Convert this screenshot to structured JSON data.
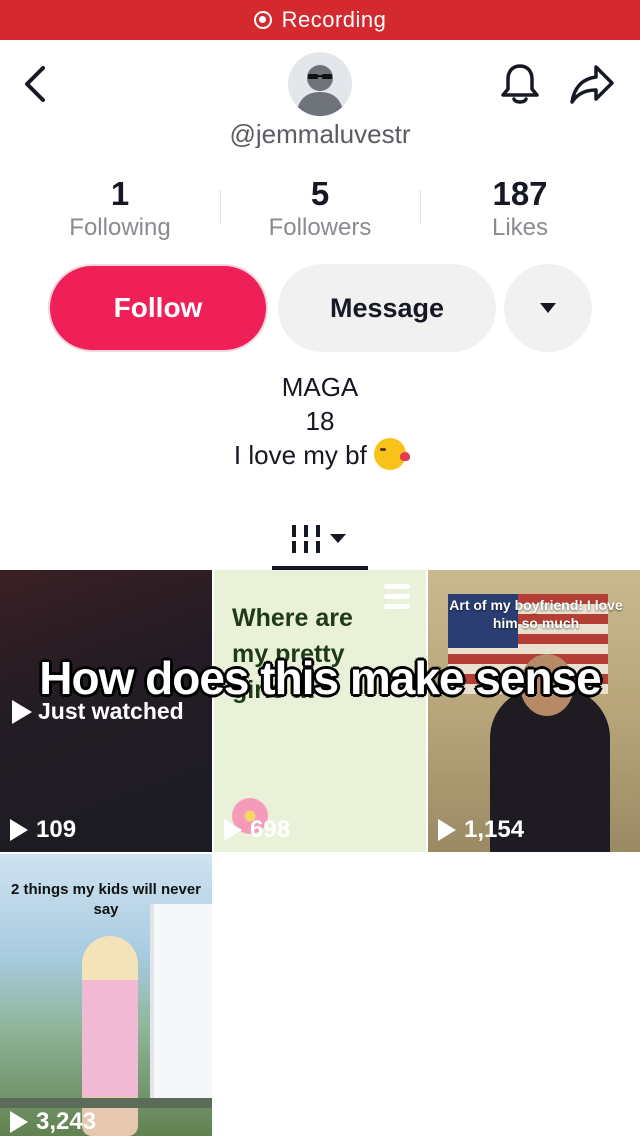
{
  "status_bar": {
    "recording_label": "Recording"
  },
  "header": {
    "back_icon": "chevron-left-icon",
    "notification_icon": "bell-icon",
    "share_icon": "share-arrow-icon",
    "username": "@jemmaluvestr"
  },
  "stats": [
    {
      "value": "1",
      "label": "Following"
    },
    {
      "value": "5",
      "label": "Followers"
    },
    {
      "value": "187",
      "label": "Likes"
    }
  ],
  "actions": {
    "follow_label": "Follow",
    "message_label": "Message",
    "more_icon": "caret-down-icon"
  },
  "bio": {
    "line1": "MAGA",
    "line2": "18",
    "line3": "I love my bf",
    "emoji": "face-blowing-kiss"
  },
  "tabs": {
    "active_icon": "videos-grid-icon"
  },
  "videos": [
    {
      "badge": "Just watched",
      "views": "109"
    },
    {
      "title": "Where are my pretty girls at",
      "views": "698"
    },
    {
      "caption": "Art of my boyfriend! I love him so much",
      "views": "1,154"
    },
    {
      "caption": "2 things my kids will never say",
      "views": "3,243"
    }
  ],
  "overlay_caption": "How does this make sense",
  "colors": {
    "recording": "#d42a2f",
    "follow": "#ef1f58",
    "secondary_button": "#f1f1f2"
  }
}
